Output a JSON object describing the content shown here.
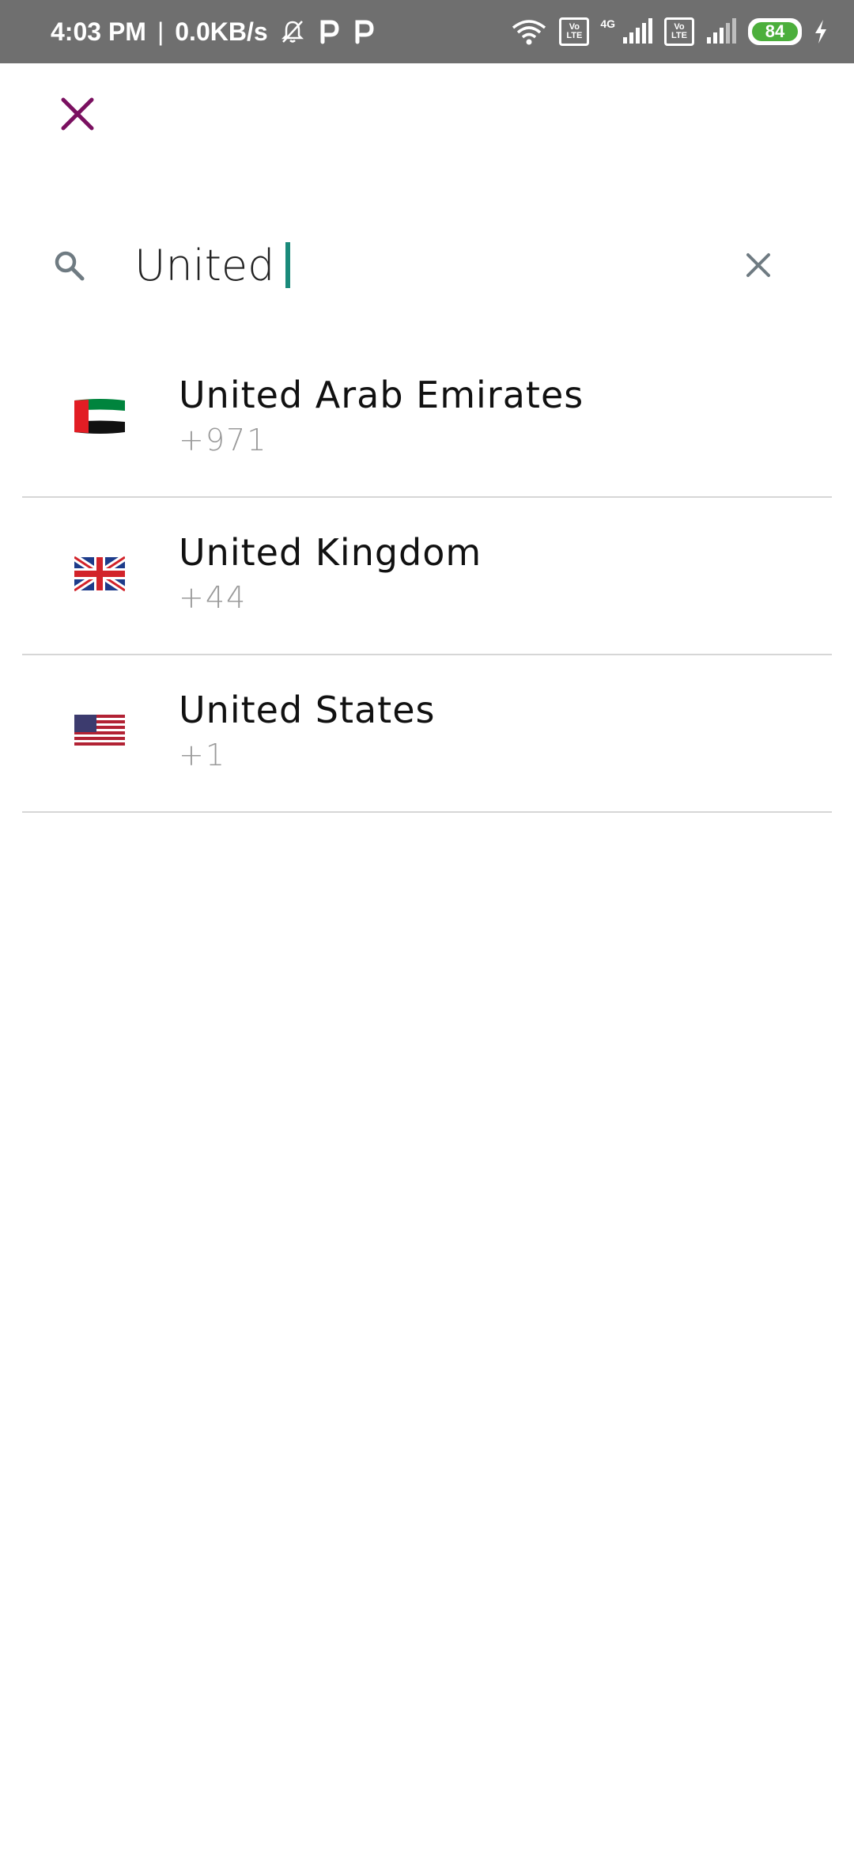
{
  "status_bar": {
    "time": "4:03 PM",
    "separator": "|",
    "speed": "0.0KB/s",
    "network_type": "4G",
    "volte_label_top": "Vo",
    "volte_label_bottom": "LTE",
    "battery": "84"
  },
  "search": {
    "value": "United"
  },
  "countries": [
    {
      "name": "United Arab Emirates",
      "code": "+971",
      "flag": "uae-flag-icon"
    },
    {
      "name": "United Kingdom",
      "code": "+44",
      "flag": "uk-flag-icon"
    },
    {
      "name": "United States",
      "code": "+1",
      "flag": "us-flag-icon"
    }
  ],
  "colors": {
    "close_accent": "#7a1060",
    "caret": "#1a8a7a",
    "status_bar": "#6f6f6f",
    "battery": "#4caf3c"
  }
}
